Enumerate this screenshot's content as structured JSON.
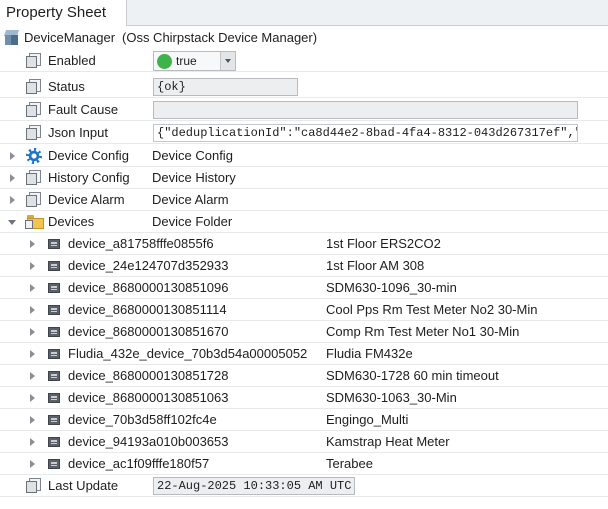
{
  "tab": {
    "title": "Property Sheet"
  },
  "root": {
    "name": "DeviceManager",
    "description": "(Oss Chirpstack Device Manager)"
  },
  "properties": {
    "enabled": {
      "label": "Enabled",
      "value": "true"
    },
    "status": {
      "label": "Status",
      "value": "{ok}"
    },
    "fault_cause": {
      "label": "Fault Cause",
      "value": ""
    },
    "json_input": {
      "label": "Json Input",
      "value": "{\"deduplicationId\":\"ca8d44e2-8bad-4fa4-8312-043d267317ef\",\"ti"
    },
    "device_config": {
      "label": "Device Config",
      "value": "Device Config"
    },
    "history_config": {
      "label": "History Config",
      "value": "Device History"
    },
    "device_alarm": {
      "label": "Device Alarm",
      "value": "Device Alarm"
    },
    "devices": {
      "label": "Devices",
      "value": "Device Folder"
    },
    "last_update": {
      "label": "Last Update",
      "value": "22-Aug-2025 10:33:05 AM UTC"
    }
  },
  "devices": [
    {
      "name": "device_a81758fffe0855f6",
      "desc": "1st Floor ERS2CO2"
    },
    {
      "name": "device_24e124707d352933",
      "desc": "1st Floor AM 308"
    },
    {
      "name": "device_8680000130851096",
      "desc": "SDM630-1096_30-min"
    },
    {
      "name": "device_8680000130851114",
      "desc": "Cool Pps Rm Test Meter No2 30-Min"
    },
    {
      "name": "device_8680000130851670",
      "desc": "Comp Rm Test Meter No1 30-Min"
    },
    {
      "name": "Fludia_432e_device_70b3d54a00005052",
      "desc": "Fludia FM432e"
    },
    {
      "name": "device_8680000130851728",
      "desc": "SDM630-1728 60 min timeout"
    },
    {
      "name": "device_8680000130851063",
      "desc": "SDM630-1063_30-Min"
    },
    {
      "name": "device_70b3d58ff102fc4e",
      "desc": "Engingo_Multi"
    },
    {
      "name": "device_94193a010b003653",
      "desc": "Kamstrap Heat Meter"
    },
    {
      "name": "device_ac1f09fffe180f57",
      "desc": "Terabee"
    }
  ],
  "colors": {
    "enabled_dot": "#3fb24a",
    "gear_icon": "#1f74c9",
    "folder_icon": "#f3c44f"
  }
}
